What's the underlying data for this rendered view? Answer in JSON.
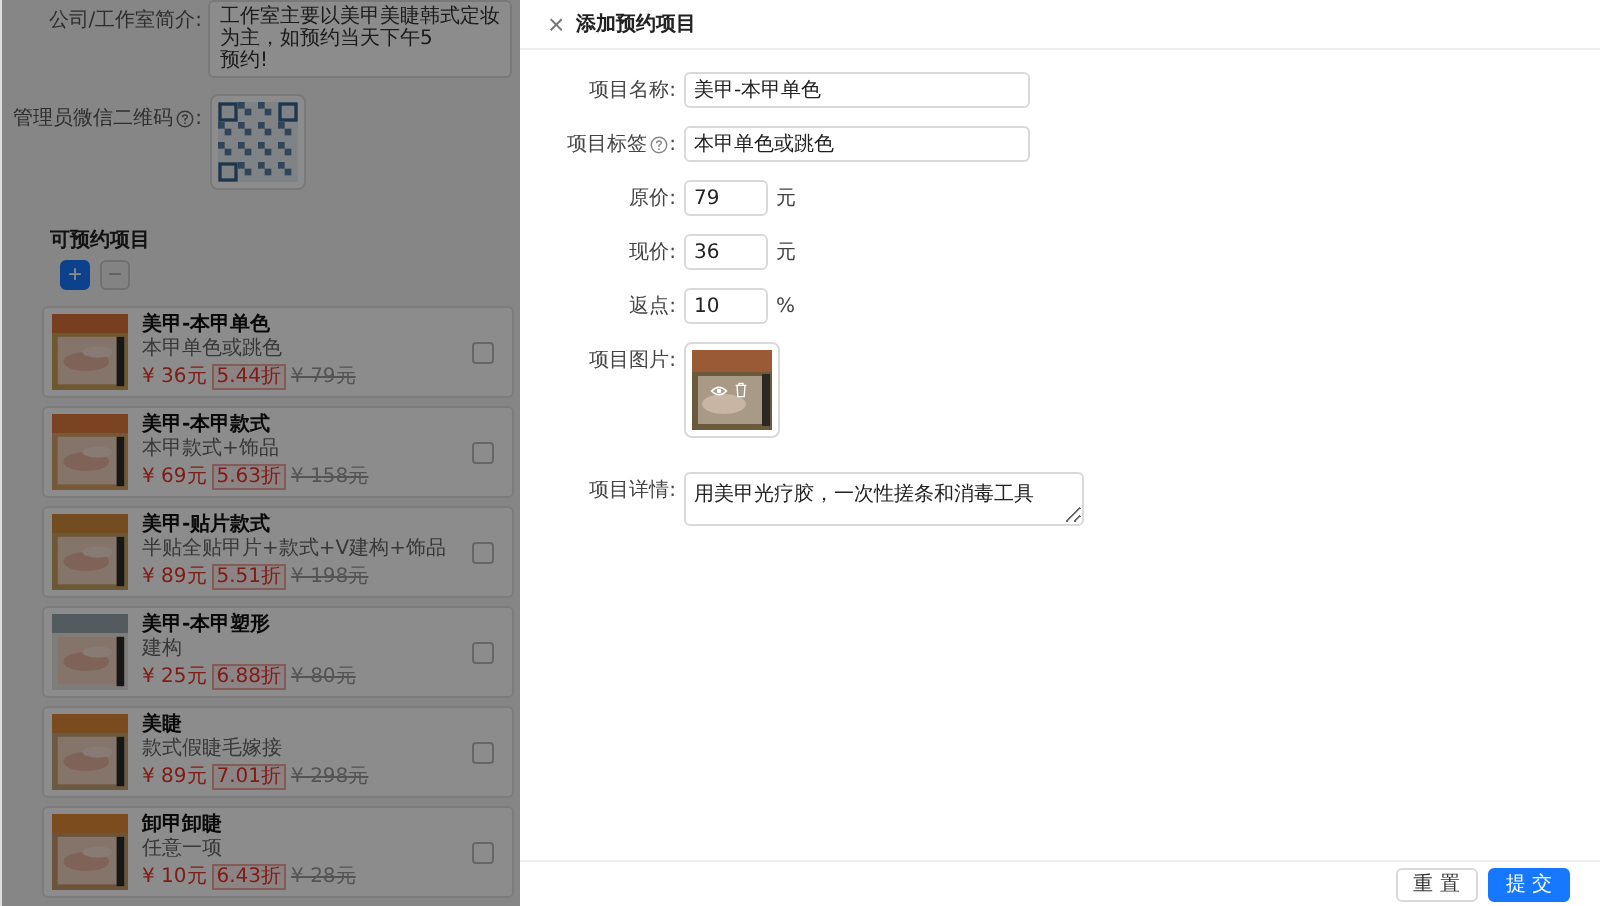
{
  "page": {
    "intro": {
      "label": "公司/工作室简介:",
      "text": "工作室主要以美甲美睫韩式定妆为主，如预约当天下午5\n预约!"
    },
    "qr": {
      "label": "管理员微信二维码",
      "help": true,
      "suffix": ":"
    },
    "section_title": "可预约项目",
    "actions": [
      {
        "label": "+",
        "disabled": false
      },
      {
        "label": "−",
        "disabled": true
      }
    ],
    "items": [
      {
        "title": "美甲-本甲单色",
        "subtitle": "本甲单色或跳色",
        "price": "¥ 36元",
        "discount": "5.44折",
        "original": "¥ 79元",
        "checked": false
      },
      {
        "title": "美甲-本甲款式",
        "subtitle": "本甲款式+饰品",
        "price": "¥ 69元",
        "discount": "5.63折",
        "original": "¥ 158元",
        "checked": false
      },
      {
        "title": "美甲-贴片款式",
        "subtitle": "半贴全贴甲片+款式+V建构+饰品",
        "price": "¥ 89元",
        "discount": "5.51折",
        "original": "¥ 198元",
        "checked": false
      },
      {
        "title": "美甲-本甲塑形",
        "subtitle": "建构",
        "price": "¥ 25元",
        "discount": "6.88折",
        "original": "¥ 80元",
        "checked": false
      },
      {
        "title": "美睫",
        "subtitle": "款式假睫毛嫁接",
        "price": "¥ 89元",
        "discount": "7.01折",
        "original": "¥ 298元",
        "checked": false
      },
      {
        "title": "卸甲卸睫",
        "subtitle": "任意一项",
        "price": "¥ 10元",
        "discount": "6.43折",
        "original": "¥ 28元",
        "checked": false
      }
    ]
  },
  "drawer": {
    "title": "添加预约项目",
    "close": "×",
    "fields": [
      {
        "kind": "text",
        "label": "项目名称:",
        "value": "美甲-本甲单色"
      },
      {
        "kind": "text",
        "label": "项目标签",
        "help": true,
        "suffix": ":",
        "value": "本甲单色或跳色"
      },
      {
        "kind": "number",
        "label": "原价:",
        "value": "79",
        "unit": "元"
      },
      {
        "kind": "number",
        "label": "现价:",
        "value": "36",
        "unit": "元"
      },
      {
        "kind": "number",
        "label": "返点:",
        "value": "10",
        "unit": "%"
      },
      {
        "label": "项目图片:"
      },
      {
        "kind": "textarea",
        "label": "项目详情:",
        "value": "用美甲光疗胶，一次性搓条和消毒工具"
      }
    ],
    "buttons": [
      {
        "label": "重 置",
        "primary": false
      },
      {
        "label": "提 交",
        "primary": true
      }
    ]
  }
}
